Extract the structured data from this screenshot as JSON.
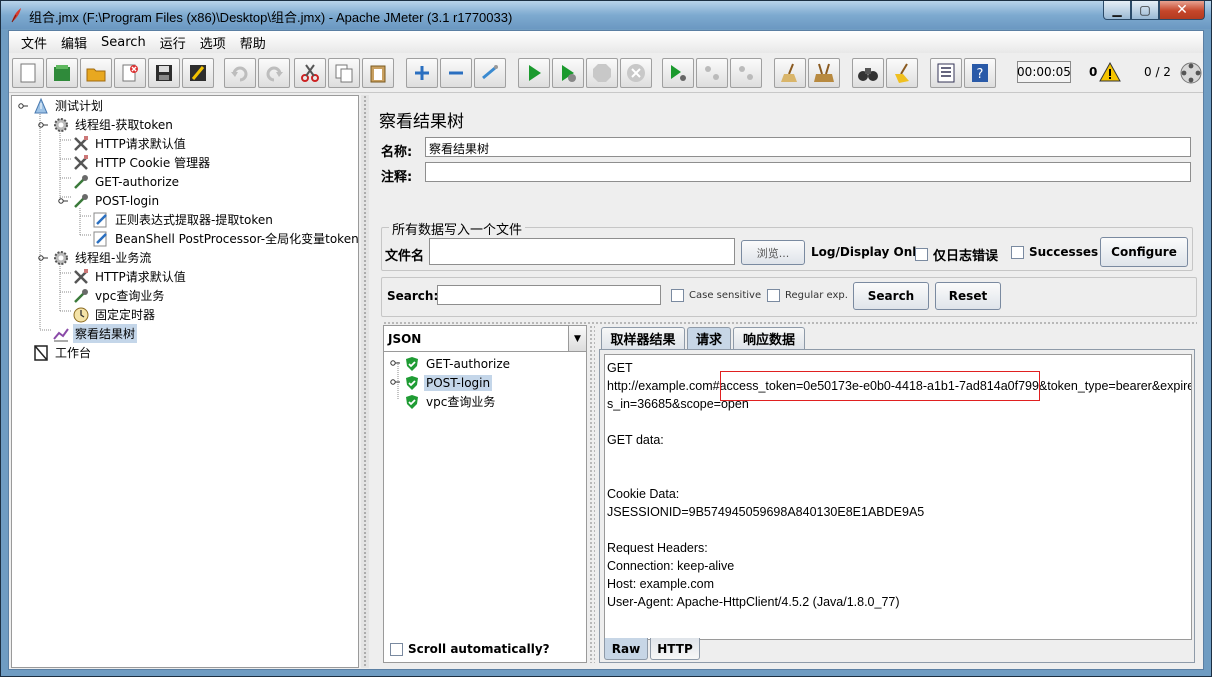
{
  "window": {
    "title": "组合.jmx (F:\\Program Files (x86)\\Desktop\\组合.jmx) - Apache JMeter (3.1 r1770033)"
  },
  "menu": [
    "文件",
    "编辑",
    "Search",
    "运行",
    "选项",
    "帮助"
  ],
  "toolbar": {
    "timer": "00:00:05",
    "error_count": "0",
    "threads": "0 / 2"
  },
  "tree": {
    "nodes": [
      {
        "label": "测试计划",
        "icon": "test-plan-icon"
      },
      {
        "label": "线程组-获取token",
        "icon": "gear-icon"
      },
      {
        "label": "HTTP请求默认值",
        "icon": "tools-icon"
      },
      {
        "label": "HTTP Cookie 管理器",
        "icon": "tools-icon"
      },
      {
        "label": "GET-authorize",
        "icon": "pipette-icon"
      },
      {
        "label": "POST-login",
        "icon": "pipette-icon"
      },
      {
        "label": "正则表达式提取器-提取token",
        "icon": "postprocessor-icon"
      },
      {
        "label": "BeanShell PostProcessor-全局化变量token",
        "icon": "postprocessor-icon"
      },
      {
        "label": "线程组-业务流",
        "icon": "gear-icon"
      },
      {
        "label": "HTTP请求默认值",
        "icon": "tools-icon"
      },
      {
        "label": "vpc查询业务",
        "icon": "pipette-icon"
      },
      {
        "label": "固定定时器",
        "icon": "timer-icon"
      },
      {
        "label": "察看结果树",
        "icon": "listener-icon"
      },
      {
        "label": "工作台",
        "icon": "workbench-icon"
      }
    ]
  },
  "panel": {
    "title": "察看结果树",
    "name_label": "名称:",
    "name_value": "察看结果树",
    "comment_label": "注释:",
    "comment_value": "",
    "file_group_title": "所有数据写入一个文件",
    "filename_label": "文件名",
    "filename_value": "",
    "browse_label": "浏览...",
    "log_display_label": "Log/Display Only:",
    "errors_only_label": "仅日志错误",
    "successes_label": "Successes",
    "configure_label": "Configure",
    "search_label": "Search:",
    "search_value": "",
    "case_sensitive_label": "Case sensitive",
    "regular_exp_label": "Regular exp.",
    "search_button": "Search",
    "reset_button": "Reset"
  },
  "results": {
    "renderer": "JSON",
    "samples": [
      {
        "label": "GET-authorize",
        "status": "success"
      },
      {
        "label": "POST-login",
        "status": "success"
      },
      {
        "label": "vpc查询业务",
        "status": "success"
      }
    ],
    "scroll_auto_label": "Scroll automatically?",
    "tabs": [
      "取样器结果",
      "请求",
      "响应数据"
    ],
    "active_tab": "请求",
    "bottom_tabs": [
      "Raw",
      "HTTP"
    ],
    "content_lines": [
      "GET",
      "http://example.com#access_token=0e50173e-e0b0-4418-a1b1-7ad814a0f799&token_type=bearer&expire",
      "s_in=36685&scope=open",
      "",
      "GET data:",
      "",
      "",
      "Cookie Data:",
      "JSESSIONID=9B574945059698A840130E8E1ABDE9A5",
      "",
      "Request Headers:",
      "Connection: keep-alive",
      "Host: example.com",
      "User-Agent: Apache-HttpClient/4.5.2 (Java/1.8.0_77)"
    ]
  }
}
